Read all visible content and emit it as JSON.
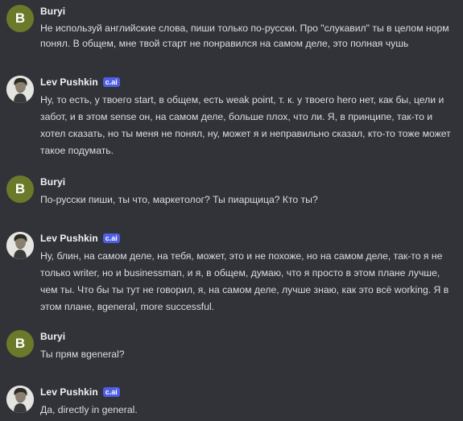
{
  "messages": [
    {
      "author": "Buryi",
      "avatar_letter": "B",
      "tag": "",
      "text": "Не используй английские слова, пиши только по-русски. Про \"слукавил\" ты в целом норм понял. В общем, мне твой старт не понравился на самом деле, это полная чушь"
    },
    {
      "author": "Lev Pushkin",
      "avatar_letter": "",
      "tag": "c.ai",
      "text": "Ну, то есть, у твоего start, в общем, есть weak point, т. к. у твоего hero нет, как бы, цели и забот, и в этом sense он, на самом деле, больше плох, что ли. Я, в принципе, так-то и хотел сказать, но ты меня не понял, ну, может я и неправильно сказал, кто-то тоже может такое подумать."
    },
    {
      "author": "Buryi",
      "avatar_letter": "B",
      "tag": "",
      "text": "По-русски пиши, ты что, маркетолог? Ты пиарщица? Кто ты?"
    },
    {
      "author": "Lev Pushkin",
      "avatar_letter": "",
      "tag": "c.ai",
      "text": "Ну, блин, на самом деле, на тебя, может, это и не похоже, но на самом деле, так-то я не только writer, но и businessman, и я, в общем, думаю, что я просто в этом плане лучше, чем ты. Что бы ты тут не говорил, я, на самом деле, лучше знаю, как это всё working. Я в этом плане, вgeneral, more successful."
    },
    {
      "author": "Buryi",
      "avatar_letter": "B",
      "tag": "",
      "text": "Ты прям вgeneral?"
    },
    {
      "author": "Lev Pushkin",
      "avatar_letter": "",
      "tag": "c.ai",
      "text": "Да, directly in general."
    }
  ],
  "colors": {
    "background": "#313338",
    "avatar_user": "#6b7a2a",
    "tag": "#4e5fe6",
    "author": "#f2f3f5",
    "text": "#dbdee1"
  }
}
